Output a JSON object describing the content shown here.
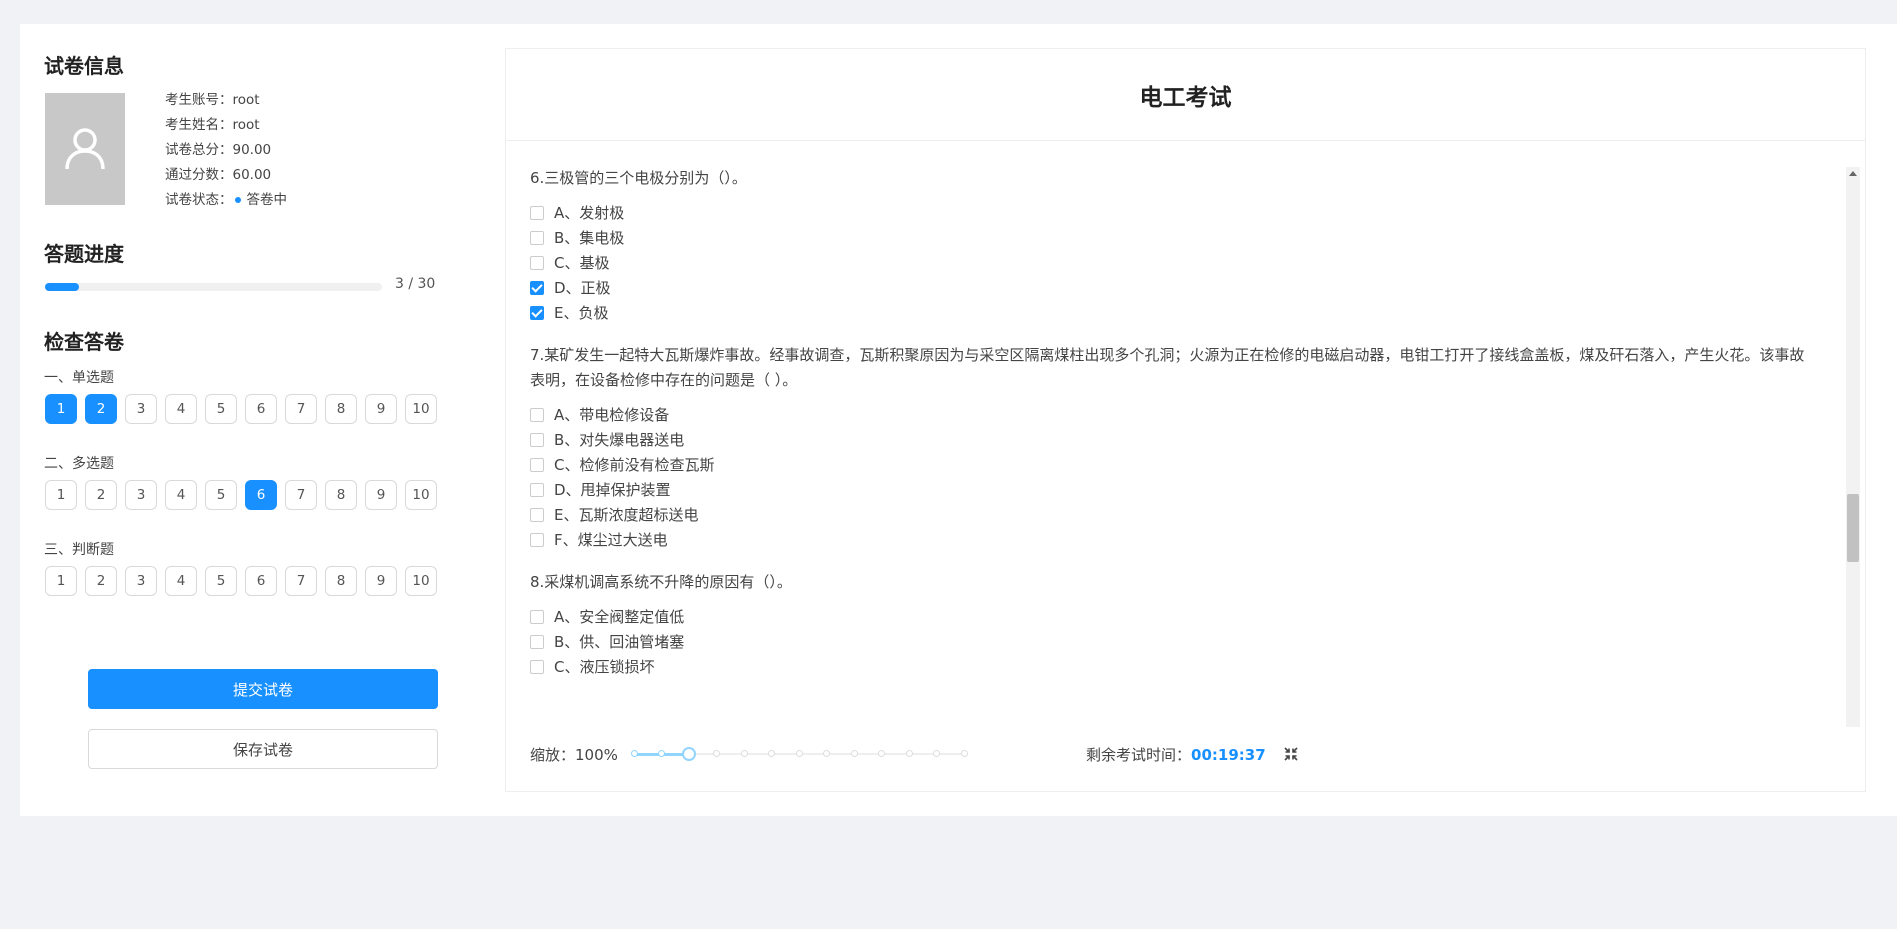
{
  "sidebar": {
    "info_title": "试卷信息",
    "info": [
      {
        "label": "考生账号：",
        "value": "root"
      },
      {
        "label": "考生姓名：",
        "value": "root"
      },
      {
        "label": "试卷总分：",
        "value": "90.00"
      },
      {
        "label": "通过分数：",
        "value": "60.00"
      },
      {
        "label": "试卷状态：",
        "value": "答卷中"
      }
    ],
    "progress_title": "答题进度",
    "progress": {
      "answered": 3,
      "total": 30,
      "text": "3 / 30"
    },
    "check_title": "检查答卷",
    "groups": [
      {
        "label": "一、单选题",
        "numbers": [
          "1",
          "2",
          "3",
          "4",
          "5",
          "6",
          "7",
          "8",
          "9",
          "10"
        ],
        "active": [
          1,
          2
        ]
      },
      {
        "label": "二、多选题",
        "numbers": [
          "1",
          "2",
          "3",
          "4",
          "5",
          "6",
          "7",
          "8",
          "9",
          "10"
        ],
        "active": [
          6
        ]
      },
      {
        "label": "三、判断题",
        "numbers": [
          "1",
          "2",
          "3",
          "4",
          "5",
          "6",
          "7",
          "8",
          "9",
          "10"
        ],
        "active": []
      }
    ],
    "submit_label": "提交试卷",
    "save_label": "保存试卷"
  },
  "exam": {
    "title": "电工考试",
    "questions": [
      {
        "text": "6.三极管的三个电极分别为（）。",
        "options": [
          {
            "text": "A、发射极",
            "checked": false
          },
          {
            "text": "B、集电极",
            "checked": false
          },
          {
            "text": "C、基极",
            "checked": false
          },
          {
            "text": "D、正极",
            "checked": true
          },
          {
            "text": "E、负极",
            "checked": true
          }
        ]
      },
      {
        "text": "7.某矿发生一起特大瓦斯爆炸事故。经事故调查，瓦斯积聚原因为与采空区隔离煤柱出现多个孔洞；火源为正在检修的电磁启动器，电钳工打开了接线盒盖板，煤及矸石落入，产生火花。该事故表明，在设备检修中存在的问题是（ ）。",
        "options": [
          {
            "text": "A、带电检修设备",
            "checked": false
          },
          {
            "text": "B、对失爆电器送电",
            "checked": false
          },
          {
            "text": "C、检修前没有检查瓦斯",
            "checked": false
          },
          {
            "text": "D、甩掉保护装置",
            "checked": false
          },
          {
            "text": "E、瓦斯浓度超标送电",
            "checked": false
          },
          {
            "text": "F、煤尘过大送电",
            "checked": false
          }
        ]
      },
      {
        "text": "8.采煤机调高系统不升降的原因有（）。",
        "options": [
          {
            "text": "A、安全阀整定值低",
            "checked": false
          },
          {
            "text": "B、供、回油管堵塞",
            "checked": false
          },
          {
            "text": "C、液压锁损坏",
            "checked": false
          }
        ]
      }
    ],
    "zoom_label": "缩放：",
    "zoom_value": "100%",
    "zoom": {
      "steps": 13,
      "current": 2
    },
    "time_label": "剩余考试时间：",
    "time_value": "00:19:37",
    "icons": {
      "avatar": "user-icon",
      "fullscreen": "fullscreen-exit-icon"
    },
    "colors": {
      "accent": "#1890ff"
    }
  }
}
